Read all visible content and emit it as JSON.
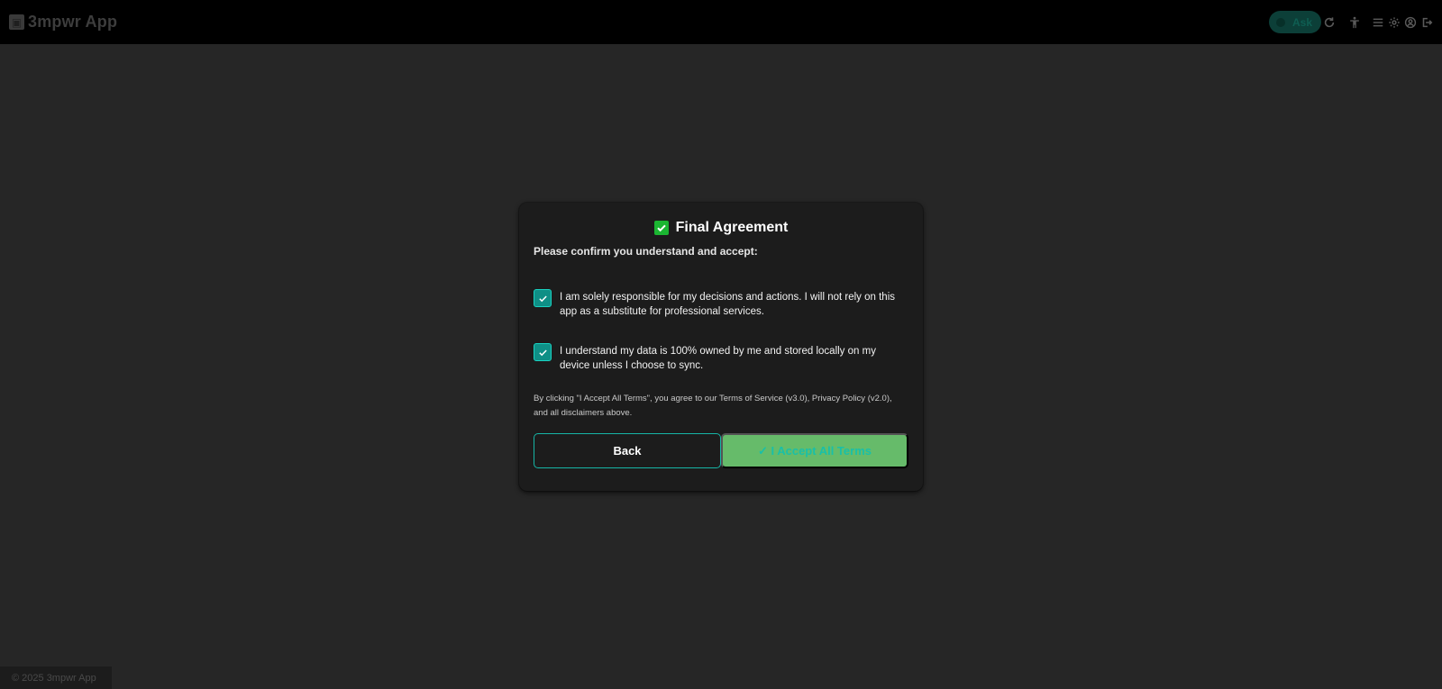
{
  "app": {
    "title": "3mpwr App",
    "logo_icon": "app-logo-icon"
  },
  "topbar": {
    "ask_label": "Ask",
    "icons": [
      "refresh-icon",
      "accessibility-icon",
      "menu-icon",
      "settings-icon",
      "user-icon",
      "logout-icon"
    ]
  },
  "modal": {
    "title_icon": "check-mark-icon",
    "title": "Final Agreement",
    "subtitle": "Please confirm you understand and accept:",
    "items": [
      {
        "checked": true,
        "text": "I am solely responsible for my decisions and actions. I will not rely on this app as a substitute for professional services."
      },
      {
        "checked": true,
        "text": "I understand my data is 100% owned by me and stored locally on my device unless I choose to sync."
      }
    ],
    "legal": "By clicking \"I Accept All Terms\", you agree to our Terms of Service (v3.0), Privacy Policy (v2.0), and all disclaimers above.",
    "back_label": "Back",
    "accept_label": "✓ I Accept All Terms"
  },
  "footer": {
    "copyright": "© 2025 3mpwr App"
  },
  "colors": {
    "page_bg": "#262626",
    "topbar_bg": "#000000",
    "modal_bg": "#1c1c1c",
    "accent_teal": "#16b5a6",
    "accept_green": "#66bb6a",
    "title_check_green": "#1bb632"
  }
}
